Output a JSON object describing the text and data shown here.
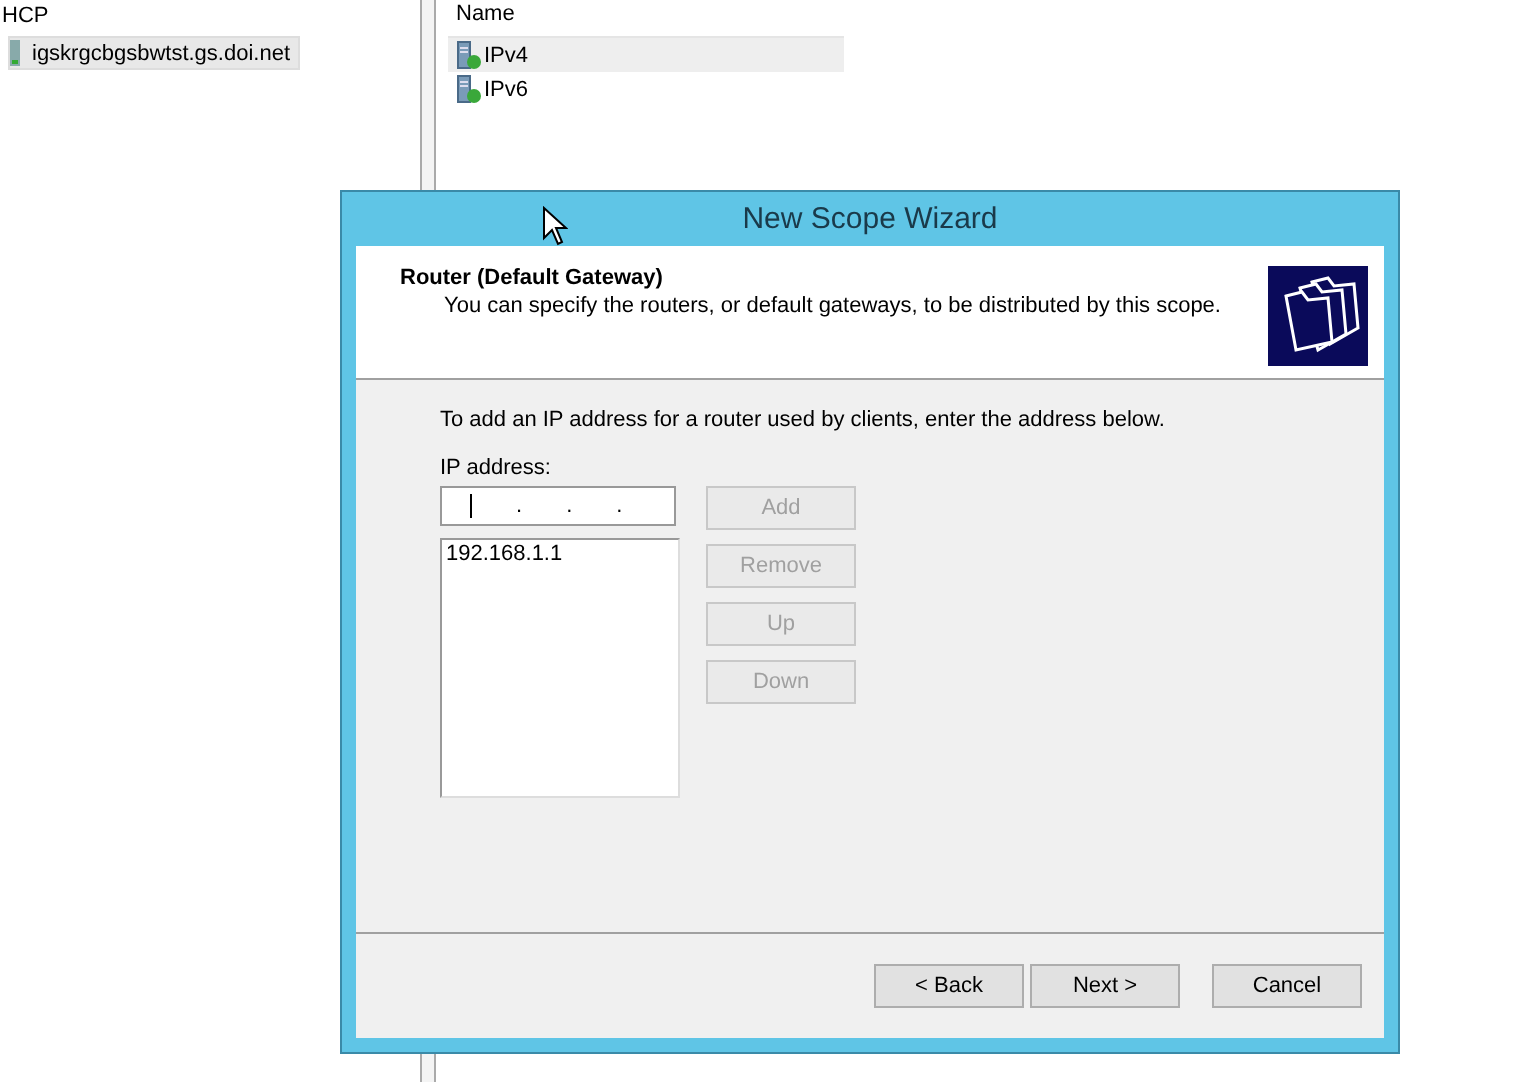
{
  "tree": {
    "root": "HCP",
    "items": [
      {
        "label": "igskrgcbgsbwtst.gs.doi.net",
        "selected": true
      }
    ]
  },
  "list": {
    "column": "Name",
    "items": [
      {
        "label": "IPv4",
        "selected": true
      },
      {
        "label": "IPv6",
        "selected": false
      }
    ]
  },
  "wizard": {
    "title": "New Scope Wizard",
    "heading": "Router (Default Gateway)",
    "subheading": "You can specify the routers, or default gateways, to be distributed by this scope.",
    "instruction": "To add an IP address for a router used by clients, enter the address below.",
    "ip_label": "IP address:",
    "ip_separator": ".",
    "side_buttons": [
      {
        "label": "Add",
        "disabled": true
      },
      {
        "label": "Remove",
        "disabled": true
      },
      {
        "label": "Up",
        "disabled": true
      },
      {
        "label": "Down",
        "disabled": true
      }
    ],
    "addresses": [
      {
        "label": "192.168.1.1",
        "selected": false
      }
    ],
    "footer_buttons": [
      {
        "label": "< Back",
        "disabled": false
      },
      {
        "label": "Next >",
        "disabled": false
      },
      {
        "label": "Cancel",
        "disabled": false
      }
    ]
  }
}
